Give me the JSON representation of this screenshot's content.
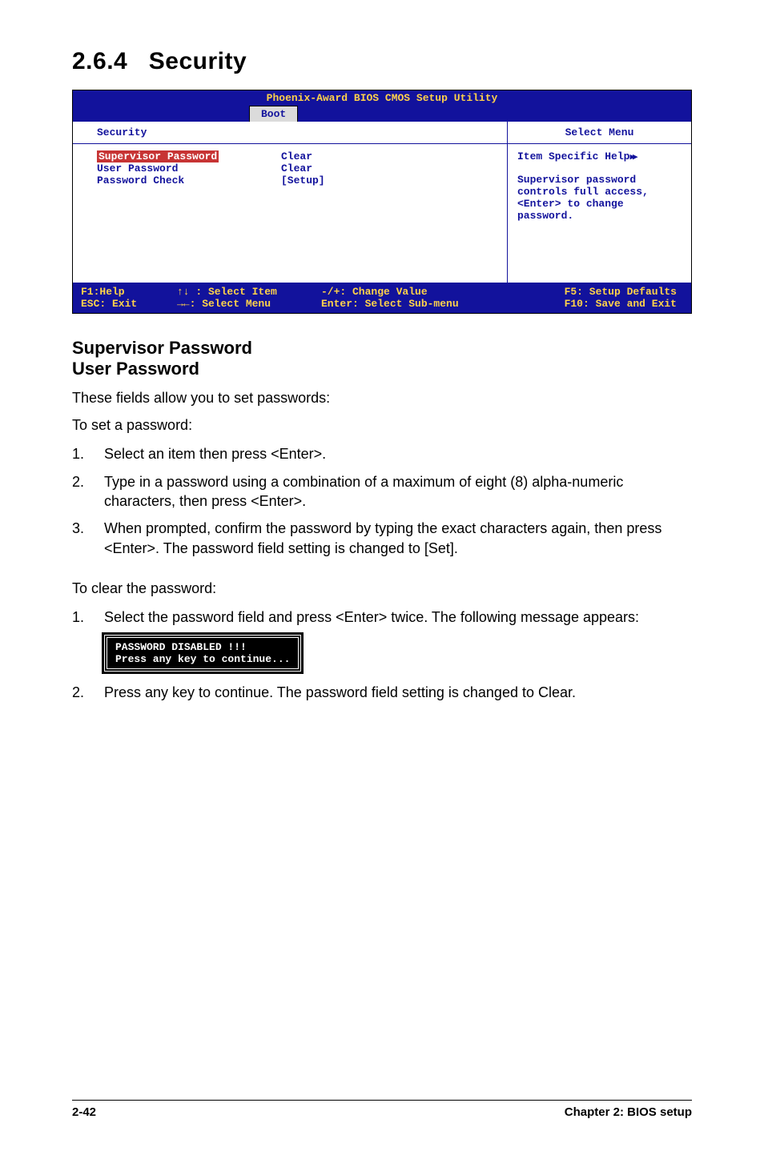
{
  "section": {
    "number": "2.6.4",
    "title": "Security"
  },
  "bios": {
    "main_title": "Phoenix-Award BIOS CMOS Setup Utility",
    "tab": "Boot",
    "left_header": "Security",
    "right_header": "Select Menu",
    "items": [
      {
        "label": "Supervisor Password",
        "value": "Clear",
        "highlight": true
      },
      {
        "label": "User Password",
        "value": "Clear",
        "highlight": false
      },
      {
        "label": "Password Check",
        "value": "[Setup]",
        "highlight": false
      }
    ],
    "help": {
      "title": "Item Specific Help",
      "body": "Supervisor password controls full access, <Enter> to change password."
    },
    "footer": {
      "f1": "F1:Help",
      "sel_item": "↑↓ : Select Item",
      "change": "-/+: Change Value",
      "f5": "F5: Setup Defaults",
      "esc": "ESC: Exit",
      "sel_menu": "→←: Select Menu",
      "enter": "Enter: Select Sub-menu",
      "f10": "F10: Save and Exit"
    }
  },
  "headings": {
    "sup": "Supervisor Password",
    "user": "User Password"
  },
  "body": {
    "intro": "These fields allow you to set passwords:",
    "toset": "To set a password:",
    "set_steps": [
      "Select an item then press <Enter>.",
      "Type in a password using a combination of a maximum of eight (8) alpha-numeric characters, then press <Enter>.",
      "When prompted, confirm the password by typing the exact characters again, then press <Enter>. The password field setting is changed to [Set]."
    ],
    "toclear": "To clear the password:",
    "clear_steps_1": "Select the password field and press <Enter> twice. The following message appears:",
    "msgbox": "PASSWORD DISABLED !!!\nPress any key to continue...",
    "clear_steps_2": "Press any key to continue. The password field setting is changed to Clear."
  },
  "footer": {
    "left": "2-42",
    "right": "Chapter 2: BIOS setup"
  }
}
